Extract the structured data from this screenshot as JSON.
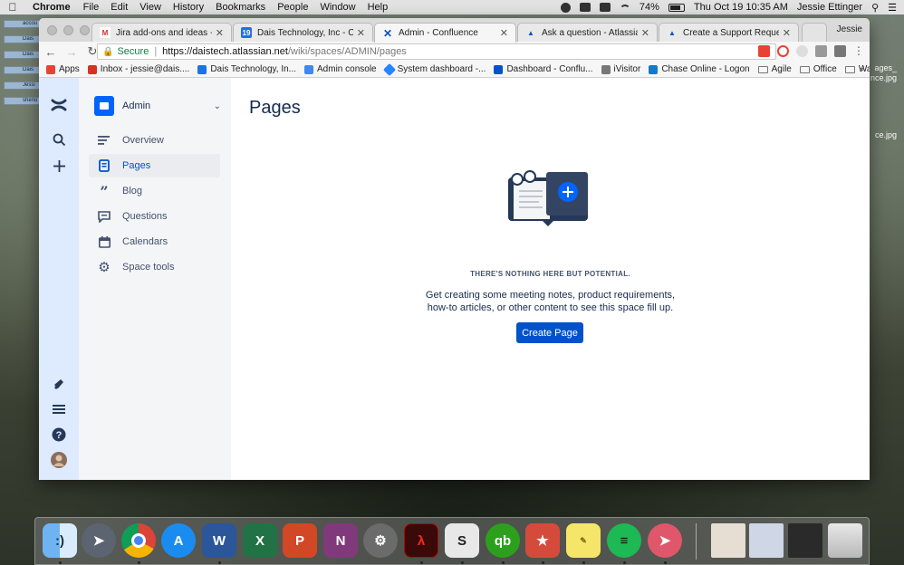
{
  "menubar": {
    "app": "Chrome",
    "items": [
      "File",
      "Edit",
      "View",
      "History",
      "Bookmarks",
      "People",
      "Window",
      "Help"
    ],
    "battery": "74%",
    "clock": "Thu Oct 19  10:35 AM",
    "user": "Jessie Ettinger"
  },
  "desktop": {
    "icons": [
      "accou",
      "Dais",
      "Dais",
      "Dais",
      "Jessi",
      "sherio"
    ],
    "files": [
      "ages_",
      "nce.jpg",
      "ce.jpg"
    ]
  },
  "browser": {
    "profile": "Jessie",
    "tabs": [
      {
        "title": "Jira add-ons and ideas - jessie",
        "favicon_color": "#d93025",
        "favicon_char": "M"
      },
      {
        "title": "Dais Technology, Inc - Calenda",
        "favicon_color": "#1a73e8",
        "favicon_char": "19"
      },
      {
        "title": "Admin - Confluence",
        "favicon_color": "#0052cc",
        "favicon_char": "✕"
      },
      {
        "title": "Ask a question - Atlassian Co",
        "favicon_color": "#0052cc",
        "favicon_char": "A"
      },
      {
        "title": "Create a Support Request - At",
        "favicon_color": "#0052cc",
        "favicon_char": "A"
      }
    ],
    "address": {
      "secure_label": "Secure",
      "host": "https://daistech.atlassian.net",
      "path": "/wiki/spaces/ADMIN/pages"
    },
    "bookmarks": [
      {
        "label": "Apps",
        "color": "#e94235",
        "type": "icon"
      },
      {
        "label": "Inbox - jessie@dais....",
        "color": "#d93025",
        "type": "icon"
      },
      {
        "label": "Dais Technology, In...",
        "color": "#1a73e8",
        "type": "icon"
      },
      {
        "label": "Admin console",
        "color": "#4285f4",
        "type": "icon"
      },
      {
        "label": "System dashboard -...",
        "color": "#2684ff",
        "type": "icon"
      },
      {
        "label": "Dashboard - Conflu...",
        "color": "#0052cc",
        "type": "icon"
      },
      {
        "label": "iVisitor",
        "color": "#777777",
        "type": "icon"
      },
      {
        "label": "Chase Online - Logon",
        "color": "#117aca",
        "type": "icon"
      },
      {
        "label": "Agile",
        "color": "",
        "type": "folder"
      },
      {
        "label": "Office",
        "color": "",
        "type": "folder"
      },
      {
        "label": "Wallboards",
        "color": "",
        "type": "folder"
      }
    ],
    "bookmarks_more": "»"
  },
  "confluence": {
    "space": {
      "name": "Admin",
      "accent": "#0065ff"
    },
    "sidebar_items": [
      {
        "label": "Overview",
        "icon": "overview-icon"
      },
      {
        "label": "Pages",
        "icon": "pages-icon",
        "selected": true
      },
      {
        "label": "Blog",
        "icon": "blog-quote-icon"
      },
      {
        "label": "Questions",
        "icon": "questions-icon"
      },
      {
        "label": "Calendars",
        "icon": "calendar-icon"
      },
      {
        "label": "Space tools",
        "icon": "gear-icon"
      }
    ],
    "page_title": "Pages",
    "empty_state": {
      "heading": "THERE'S NOTHING HERE BUT POTENTIAL.",
      "line1": "Get creating some meeting notes, product requirements,",
      "line2": "how-to articles, or other content to see this space fill up.",
      "button": "Create Page"
    },
    "colors": {
      "global_nav": "#deebff",
      "sidebar": "#f4f5f7",
      "primary": "#0052cc"
    }
  },
  "dock": {
    "apps": [
      "Finder",
      "Launchpad",
      "Chrome",
      "App Store",
      "Word",
      "Excel",
      "PowerPoint",
      "OneNote",
      "System Preferences",
      "Acrobat",
      "Slack",
      "QuickBooks",
      "Wunderlist",
      "Stickies",
      "Spotify",
      "Airmail"
    ],
    "downloads": [
      "Document stack",
      "Desktop stack",
      "Screenshots stack",
      "Trash"
    ]
  }
}
